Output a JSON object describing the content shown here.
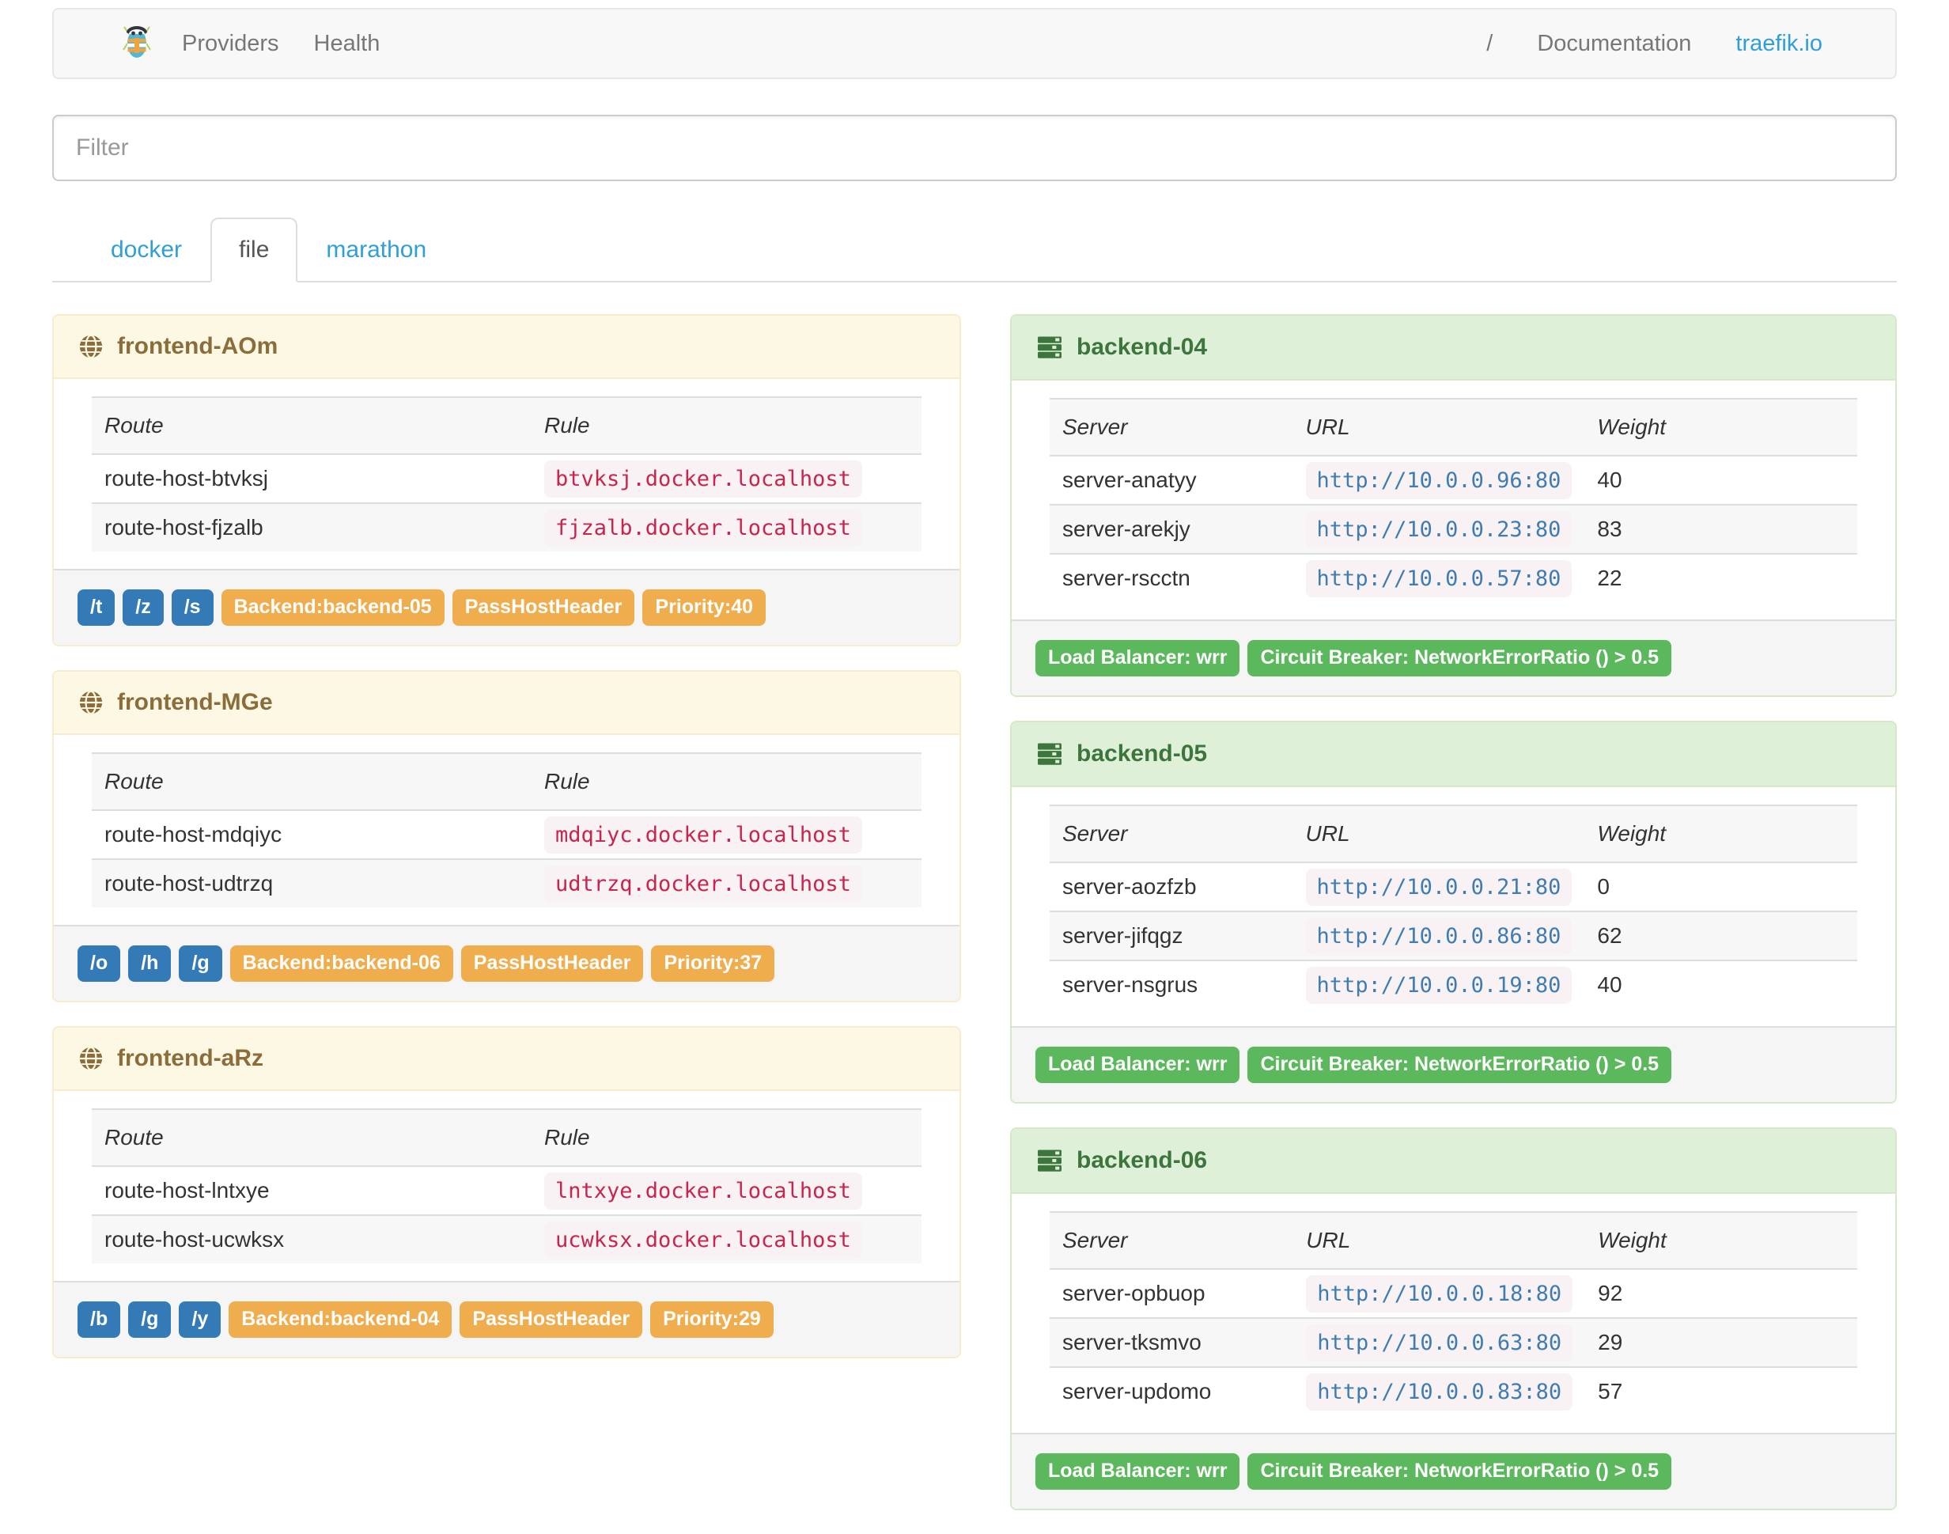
{
  "navbar": {
    "brand_icon": "traefik-logo",
    "providers_label": "Providers",
    "health_label": "Health",
    "separator": "/",
    "documentation_label": "Documentation",
    "site_label": "traefik.io"
  },
  "filter": {
    "placeholder": "Filter"
  },
  "tabs": {
    "docker": "docker",
    "file": "file",
    "marathon": "marathon",
    "active_tab": "file"
  },
  "headers": {
    "frontend": [
      "Route",
      "Rule"
    ],
    "backend": [
      "Server",
      "URL",
      "Weight"
    ]
  },
  "frontends": [
    {
      "title": "frontend-AOm",
      "routes": [
        {
          "route": "route-host-btvksj",
          "rule": "btvksj.docker.localhost"
        },
        {
          "route": "route-host-fjzalb",
          "rule": "fjzalb.docker.localhost"
        }
      ],
      "entry_points": [
        "/t",
        "/z",
        "/s"
      ],
      "tags": [
        "Backend:backend-05",
        "PassHostHeader",
        "Priority:40"
      ]
    },
    {
      "title": "frontend-MGe",
      "routes": [
        {
          "route": "route-host-mdqiyc",
          "rule": "mdqiyc.docker.localhost"
        },
        {
          "route": "route-host-udtrzq",
          "rule": "udtrzq.docker.localhost"
        }
      ],
      "entry_points": [
        "/o",
        "/h",
        "/g"
      ],
      "tags": [
        "Backend:backend-06",
        "PassHostHeader",
        "Priority:37"
      ]
    },
    {
      "title": "frontend-aRz",
      "routes": [
        {
          "route": "route-host-lntxye",
          "rule": "lntxye.docker.localhost"
        },
        {
          "route": "route-host-ucwksx",
          "rule": "ucwksx.docker.localhost"
        }
      ],
      "entry_points": [
        "/b",
        "/g",
        "/y"
      ],
      "tags": [
        "Backend:backend-04",
        "PassHostHeader",
        "Priority:29"
      ]
    }
  ],
  "backends": [
    {
      "title": "backend-04",
      "servers": [
        {
          "server": "server-anatyy",
          "url": "http://10.0.0.96:80",
          "weight": "40"
        },
        {
          "server": "server-arekjy",
          "url": "http://10.0.0.23:80",
          "weight": "83"
        },
        {
          "server": "server-rscctn",
          "url": "http://10.0.0.57:80",
          "weight": "22"
        }
      ],
      "badges": [
        "Load Balancer: wrr",
        "Circuit Breaker: NetworkErrorRatio () > 0.5"
      ]
    },
    {
      "title": "backend-05",
      "servers": [
        {
          "server": "server-aozfzb",
          "url": "http://10.0.0.21:80",
          "weight": "0"
        },
        {
          "server": "server-jifqgz",
          "url": "http://10.0.0.86:80",
          "weight": "62"
        },
        {
          "server": "server-nsgrus",
          "url": "http://10.0.0.19:80",
          "weight": "40"
        }
      ],
      "badges": [
        "Load Balancer: wrr",
        "Circuit Breaker: NetworkErrorRatio () > 0.5"
      ]
    },
    {
      "title": "backend-06",
      "servers": [
        {
          "server": "server-opbuop",
          "url": "http://10.0.0.18:80",
          "weight": "92"
        },
        {
          "server": "server-tksmvo",
          "url": "http://10.0.0.63:80",
          "weight": "29"
        },
        {
          "server": "server-updomo",
          "url": "http://10.0.0.83:80",
          "weight": "57"
        }
      ],
      "badges": [
        "Load Balancer: wrr",
        "Circuit Breaker: NetworkErrorRatio () > 0.5"
      ]
    }
  ],
  "colors": {
    "link_blue": "#2f9fd7",
    "navbar_bg": "#f8f8f8",
    "label_primary": "#337ab7",
    "label_warning": "#f0ad4e",
    "label_success": "#5cb85c",
    "code_text": "#c7254e",
    "code_bg": "#f9f2f4",
    "url_blue": "#3e7cb1",
    "panel_warning_bg": "#fcf8e3",
    "panel_warning_border": "#faebcc",
    "panel_warning_text": "#8a6d3b",
    "panel_success_bg": "#dff0d8",
    "panel_success_border": "#d6e9c6",
    "panel_success_text": "#3c763d"
  }
}
